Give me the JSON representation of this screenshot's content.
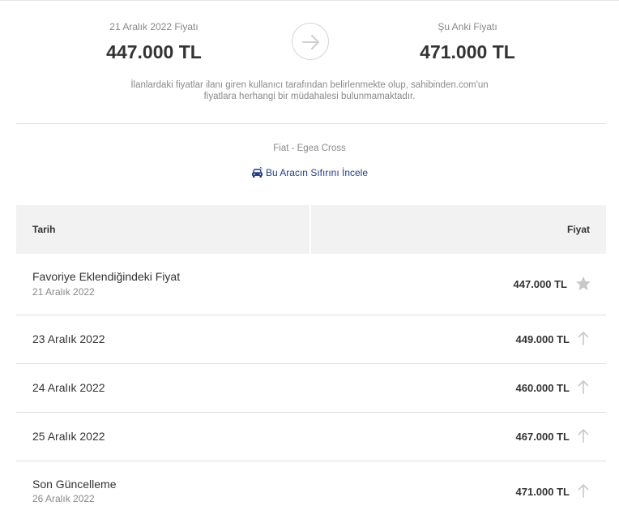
{
  "header": {
    "old_price_label": "21 Aralık 2022 Fiyatı",
    "old_price_value": "447.000 TL",
    "current_price_label": "Şu Anki Fiyatı",
    "current_price_value": "471.000 TL",
    "disclaimer_line1": "İlanlardaki fiyatlar ilanı giren kullanıcı tarafından belirlenmekte olup, sahibinden.com'un",
    "disclaimer_line2": "fiyatlara herhangi bir müdahalesi bulunmamaktadır."
  },
  "vehicle": {
    "model": "Fiat - Egea Cross",
    "link_label": "Bu Aracın Sıfırını İncele",
    "link_icon": "car-icon",
    "link_color": "#1e3f94"
  },
  "table": {
    "col_date": "Tarih",
    "col_price": "Fiyat",
    "rows": [
      {
        "title": "Favoriye Eklendiğindeki Fiyat",
        "subtitle": "21 Aralık 2022",
        "price": "447.000 TL",
        "icon": "star-icon"
      },
      {
        "title": "23 Aralık 2022",
        "subtitle": "",
        "price": "449.000 TL",
        "icon": "arrow-up-icon"
      },
      {
        "title": "24 Aralık 2022",
        "subtitle": "",
        "price": "460.000 TL",
        "icon": "arrow-up-icon"
      },
      {
        "title": "25 Aralık 2022",
        "subtitle": "",
        "price": "467.000 TL",
        "icon": "arrow-up-icon"
      },
      {
        "title": "Son Güncelleme",
        "subtitle": "26 Aralık 2022",
        "price": "471.000 TL",
        "icon": "arrow-up-icon"
      }
    ]
  }
}
